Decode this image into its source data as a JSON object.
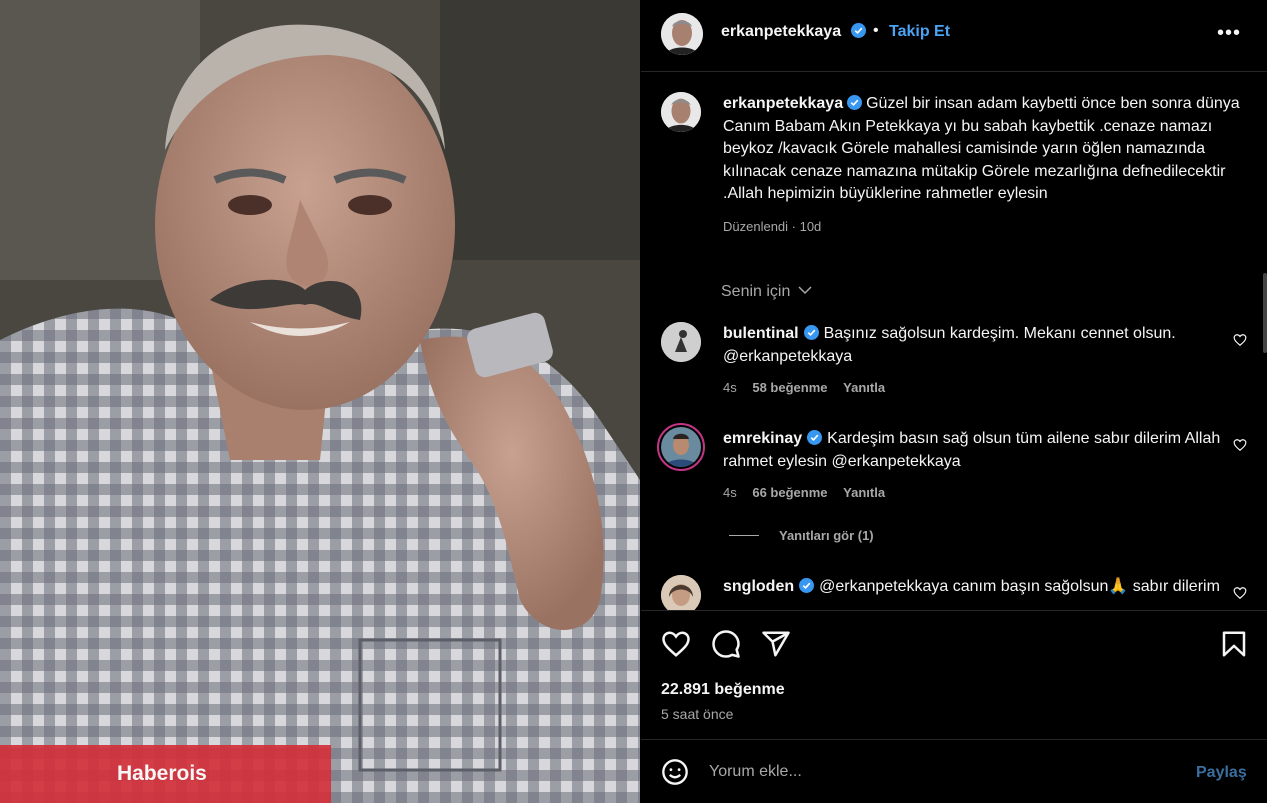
{
  "photo": {
    "watermark": "Haberois"
  },
  "header": {
    "username": "erkanpetekkaya",
    "separator": "•",
    "follow_label": "Takip Et",
    "more_label": "•••"
  },
  "caption": {
    "username": "erkanpetekkaya",
    "text": "Güzel bir insan adam kaybetti önce ben sonra dünya Canım Babam Akın Petekkaya yı bu sabah kaybettik .cenaze namazı beykoz /kavacık Görele mahallesi camisinde yarın öğlen namazında kılınacak cenaze namazına mütakip Görele mezarlığına defnedilecektir .Allah hepimizin büyüklerine rahmetler eylesin",
    "meta": "Düzenlendi · 10d"
  },
  "for_you": "Senin için",
  "comments": [
    {
      "username": "bulentinal",
      "text": "Başınız sağolsun kardeşim. Mekanı cennet olsun. @erkanpetekkaya",
      "age": "4s",
      "likes": "58 beğenme",
      "reply": "Yanıtla"
    },
    {
      "username": "emrekinay",
      "text": "Kardeşim basın sağ olsun tüm ailene sabır dilerim Allah rahmet eylesin @erkanpetekkaya",
      "age": "4s",
      "likes": "66 beğenme",
      "reply": "Yanıtla",
      "view_replies": "Yanıtları gör (1)"
    },
    {
      "username": "sngloden",
      "text": "@erkanpetekkaya canım başın sağolsun🙏 sabır dilerim",
      "age": "",
      "likes": "",
      "reply": ""
    }
  ],
  "stats": {
    "likes": "22.891 beğenme",
    "time": "5 saat önce"
  },
  "comment_box": {
    "placeholder": "Yorum ekle...",
    "share_label": "Paylaş"
  },
  "colors": {
    "accent": "#4aa3f5",
    "verified": "#3897f0",
    "watermark_bg": "#d2303a"
  },
  "icons": [
    "verified-badge-icon",
    "heart-icon",
    "comment-icon",
    "share-icon",
    "bookmark-icon",
    "emoji-icon",
    "chevron-down-icon",
    "more-icon"
  ]
}
